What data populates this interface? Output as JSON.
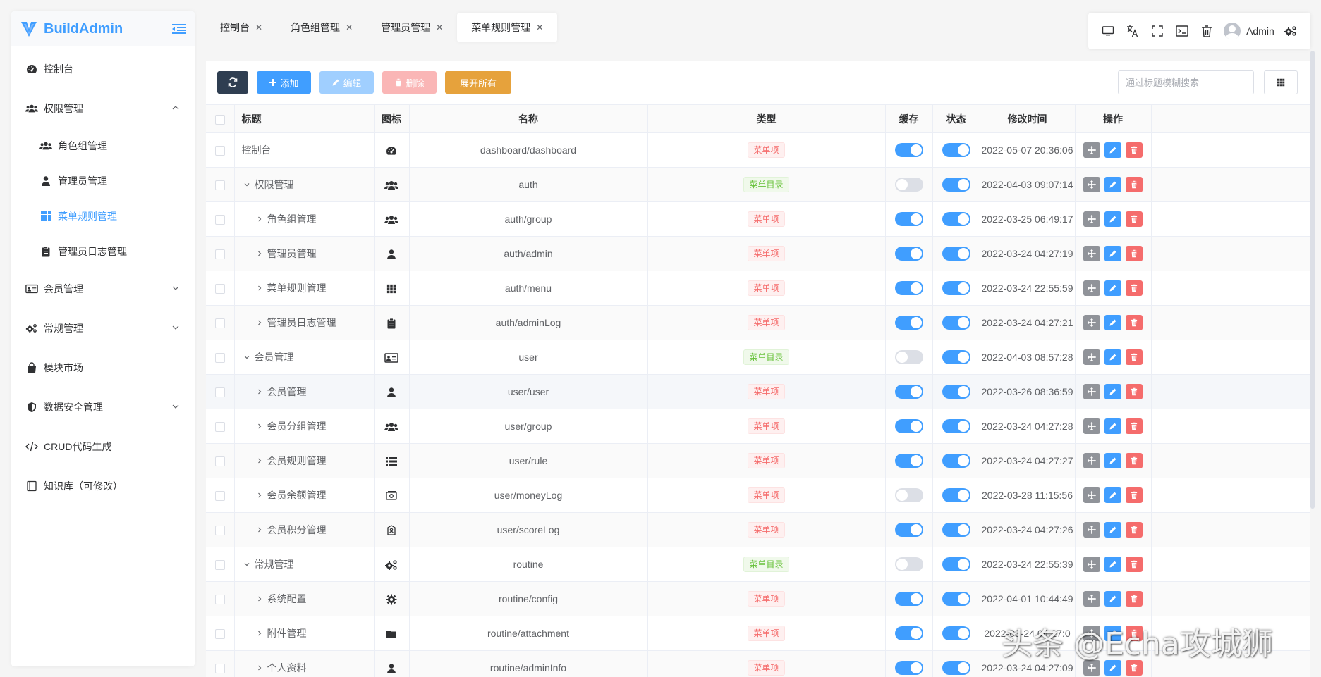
{
  "app": {
    "name": "BuildAdmin",
    "brand_color": "#409eff"
  },
  "sidebar": {
    "items": [
      {
        "label": "控制台",
        "icon": "dashboard-icon"
      },
      {
        "label": "权限管理",
        "icon": "users-icon"
      },
      {
        "label": "角色组管理",
        "icon": "users-icon"
      },
      {
        "label": "管理员管理",
        "icon": "user-icon"
      },
      {
        "label": "菜单规则管理",
        "icon": "grid-icon"
      },
      {
        "label": "管理员日志管理",
        "icon": "clipboard-icon"
      },
      {
        "label": "会员管理",
        "icon": "id-card-icon"
      },
      {
        "label": "常规管理",
        "icon": "gears-icon"
      },
      {
        "label": "模块市场",
        "icon": "shopping-bag-icon"
      },
      {
        "label": "数据安全管理",
        "icon": "shield-icon"
      },
      {
        "label": "CRUD代码生成",
        "icon": "code-icon"
      },
      {
        "label": "知识库（可修改）",
        "icon": "book-icon"
      }
    ]
  },
  "tabs": [
    {
      "label": "控制台"
    },
    {
      "label": "角色组管理"
    },
    {
      "label": "管理员管理"
    },
    {
      "label": "菜单规则管理"
    }
  ],
  "navbar": {
    "user": "Admin"
  },
  "toolbar": {
    "add": "添加",
    "edit": "编辑",
    "delete": "删除",
    "expand": "展开所有",
    "search_placeholder": "通过标题模糊搜索"
  },
  "table": {
    "headers": [
      "标题",
      "图标",
      "名称",
      "类型",
      "缓存",
      "状态",
      "修改时间",
      "操作"
    ],
    "type_labels": {
      "item": "菜单项",
      "dir": "菜单目录"
    },
    "rows": [
      {
        "title": "控制台",
        "icon": "dashboard-icon",
        "name": "dashboard/dashboard",
        "type": "菜单项",
        "cache": true,
        "status": true,
        "time": "2022-05-07 20:36:06"
      },
      {
        "title": "权限管理",
        "icon": "users-icon",
        "name": "auth",
        "type": "菜单目录",
        "cache": false,
        "status": true,
        "time": "2022-04-03 09:07:14"
      },
      {
        "title": "角色组管理",
        "icon": "users-icon",
        "name": "auth/group",
        "type": "菜单项",
        "cache": true,
        "status": true,
        "time": "2022-03-25 06:49:17"
      },
      {
        "title": "管理员管理",
        "icon": "user-icon",
        "name": "auth/admin",
        "type": "菜单项",
        "cache": true,
        "status": true,
        "time": "2022-03-24 04:27:19"
      },
      {
        "title": "菜单规则管理",
        "icon": "grid-icon",
        "name": "auth/menu",
        "type": "菜单项",
        "cache": true,
        "status": true,
        "time": "2022-03-24 22:55:59"
      },
      {
        "title": "管理员日志管理",
        "icon": "clipboard-icon",
        "name": "auth/adminLog",
        "type": "菜单项",
        "cache": true,
        "status": true,
        "time": "2022-03-24 04:27:21"
      },
      {
        "title": "会员管理",
        "icon": "id-card-icon",
        "name": "user",
        "type": "菜单目录",
        "cache": false,
        "status": true,
        "time": "2022-04-03 08:57:28"
      },
      {
        "title": "会员管理",
        "icon": "user-icon",
        "name": "user/user",
        "type": "菜单项",
        "cache": true,
        "status": true,
        "time": "2022-03-26 08:36:59"
      },
      {
        "title": "会员分组管理",
        "icon": "users-icon",
        "name": "user/group",
        "type": "菜单项",
        "cache": true,
        "status": true,
        "time": "2022-03-24 04:27:28"
      },
      {
        "title": "会员规则管理",
        "icon": "list-icon",
        "name": "user/rule",
        "type": "菜单项",
        "cache": true,
        "status": true,
        "time": "2022-03-24 04:27:27"
      },
      {
        "title": "会员余额管理",
        "icon": "money-icon",
        "name": "user/moneyLog",
        "type": "菜单项",
        "cache": false,
        "status": true,
        "time": "2022-03-28 11:15:56"
      },
      {
        "title": "会员积分管理",
        "icon": "tag-icon",
        "name": "user/scoreLog",
        "type": "菜单项",
        "cache": true,
        "status": true,
        "time": "2022-03-24 04:27:26"
      },
      {
        "title": "常规管理",
        "icon": "gears-icon",
        "name": "routine",
        "type": "菜单目录",
        "cache": false,
        "status": true,
        "time": "2022-03-24 22:55:39"
      },
      {
        "title": "系统配置",
        "icon": "gear-icon",
        "name": "routine/config",
        "type": "菜单项",
        "cache": true,
        "status": true,
        "time": "2022-04-01 10:44:49"
      },
      {
        "title": "附件管理",
        "icon": "folder-icon",
        "name": "routine/attachment",
        "type": "菜单项",
        "cache": true,
        "status": true,
        "time": "2022-03-24 04:27:0"
      },
      {
        "title": "个人资料",
        "icon": "user-icon",
        "name": "routine/adminInfo",
        "type": "菜单项",
        "cache": true,
        "status": true,
        "time": "2022-03-24 04:27:09"
      }
    ]
  },
  "watermark": "头条 @Echa攻城狮"
}
